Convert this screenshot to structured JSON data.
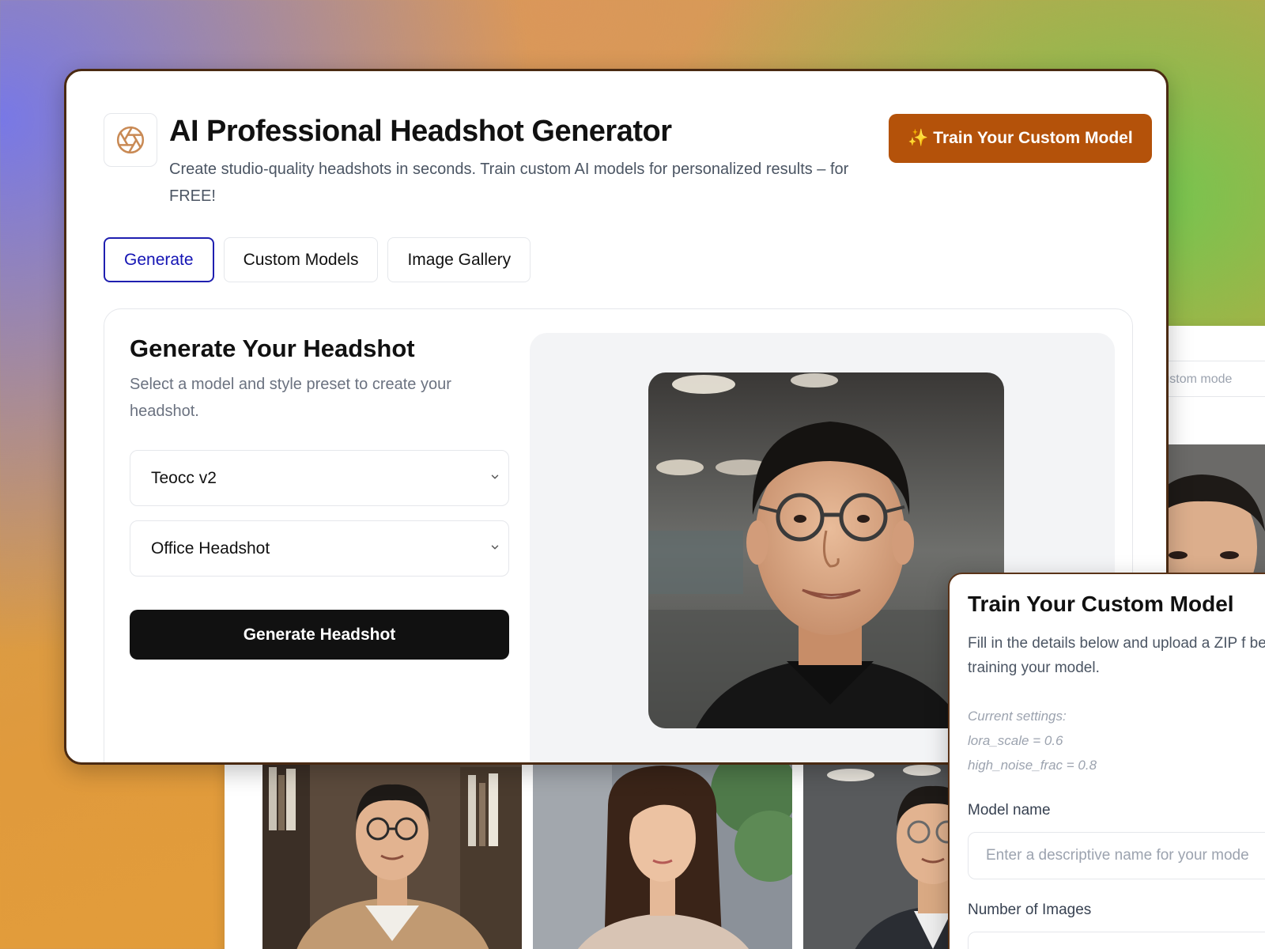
{
  "header": {
    "title": "AI Professional Headshot Generator",
    "subtitle": "Create studio-quality headshots in seconds. Train custom AI models for personalized results – for FREE!",
    "train_button": "✨ Train Your Custom Model"
  },
  "tabs": [
    {
      "label": "Generate",
      "active": true
    },
    {
      "label": "Custom Models",
      "active": false
    },
    {
      "label": "Image Gallery",
      "active": false
    }
  ],
  "generate": {
    "title": "Generate Your Headshot",
    "subtitle": "Select a model and style preset to create your headshot.",
    "model_select": "Teocc v2",
    "style_select": "Office Headshot",
    "button": "Generate Headshot"
  },
  "background_panel": {
    "placeholder_fragment": "a custom mode"
  },
  "train_modal": {
    "title": "Train Your Custom Model",
    "description": "Fill in the details below and upload a ZIP f begin training your model.",
    "settings_line1": "Current settings:",
    "settings_line2": "lora_scale = 0.6",
    "settings_line3": "high_noise_frac = 0.8",
    "model_name_label": "Model name",
    "model_name_placeholder": "Enter a descriptive name for your mode",
    "num_images_label": "Number of Images"
  },
  "colors": {
    "accent_orange": "#b4520a",
    "active_tab_blue": "#1414b4",
    "primary_button": "#111111"
  },
  "icons": {
    "logo": "aperture-icon",
    "select_arrow": "chevron-down-icon"
  }
}
